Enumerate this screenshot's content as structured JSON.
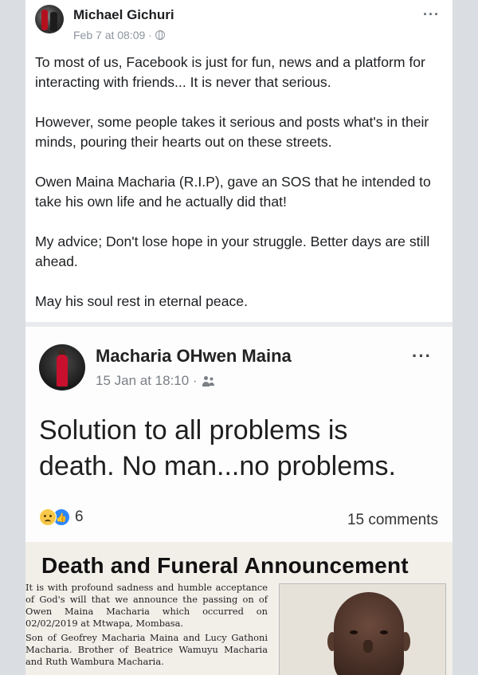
{
  "post": {
    "author": "Michael Gichuri",
    "date": "Feb 7 at 08:09 ·",
    "privacy_icon": "globe-icon",
    "more_label": "···",
    "paragraphs": [
      "To most of us, Facebook is just for fun, news and a platform for interacting with friends... It is never that serious.",
      "However, some people takes it serious and posts what's in their minds, pouring their hearts out on these streets.",
      "Owen Maina Macharia (R.I.P), gave an SOS that he intended to take his own life and he actually did that!",
      "My advice; Don't lose hope in your struggle. Better days are still ahead.",
      "May his soul rest in eternal peace."
    ]
  },
  "shared": {
    "author": "Macharia OHwen Maina",
    "date": "15 Jan at 18:10 ·",
    "privacy_icon": "friends-icon",
    "more_label": "···",
    "status_lines": [
      "Solution to all problems is",
      "death. No man...no problems."
    ],
    "reaction_count": "6",
    "comments": "15 comments"
  },
  "announcement": {
    "title": "Death and Funeral Announcement",
    "paragraphs": [
      "It is with profound sadness and humble acceptance of God's will that we announce the passing on of Owen Maina Macharia which occurred on 02/02/2019 at Mtwapa, Mombasa.",
      "Son of Geofrey Macharia Maina and Lucy Gathoni Macharia. Brother of Beatrice Wamuyu Macharia and Ruth Wambura Macharia."
    ]
  }
}
